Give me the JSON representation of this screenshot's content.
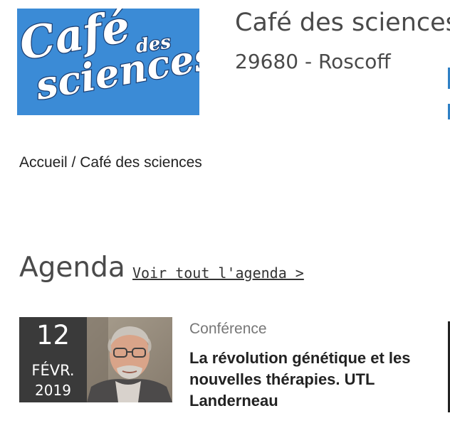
{
  "header": {
    "logo": {
      "alt": "Café des sciences logo",
      "lines": [
        "Café",
        "des",
        "sciences"
      ]
    },
    "org_name": "Café des sciences",
    "location": "29680 - Roscoff"
  },
  "breadcrumb": {
    "home": "Accueil",
    "separator": " / ",
    "current": "Café des sciences"
  },
  "agenda": {
    "heading": "Agenda",
    "see_all_link": "Voir tout l'agenda >"
  },
  "events": [
    {
      "day": "12",
      "month": "FÉVR.",
      "year": "2019",
      "category": "Conférence",
      "title": "La révolution génétique et les nouvelles thérapies. UTL Landerneau"
    }
  ],
  "colors": {
    "logo_bg": "#3b8bd6",
    "date_box_bg": "#3a3a3a",
    "accent_edge": "#2f80c5",
    "heading_text": "#4a4a4a",
    "category_text": "#777777"
  }
}
